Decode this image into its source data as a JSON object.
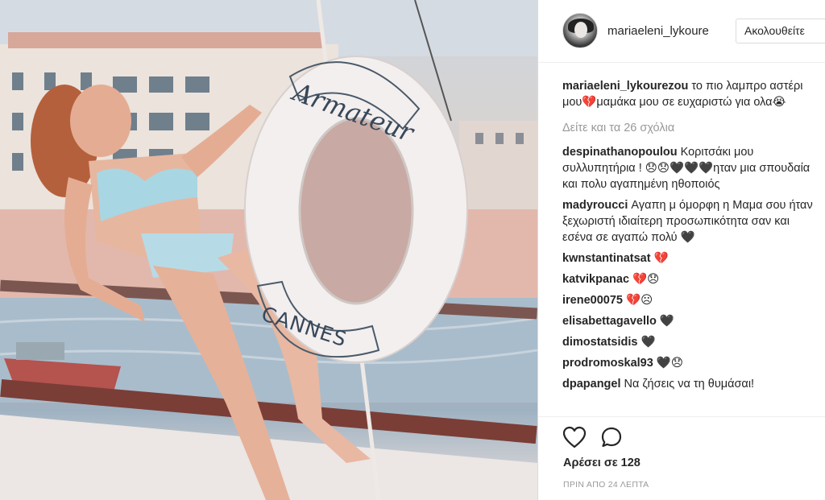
{
  "post": {
    "username": "mariaeleni_lykoure",
    "follow_label": "Ακολουθείτε",
    "caption_user": "mariaeleni_lykourezou",
    "caption_text": " το πιο λαμπρο αστέρι μου💔μαμάκα μου σε ευχαριστώ για ολα😭",
    "view_all": "Δείτε και τα 26 σχόλια",
    "likes": "Αρέσει σε 128",
    "time": "ΠΡΙΝ ΑΠΟ 24 ΛΕΠΤΑ"
  },
  "comments": [
    {
      "user": "despinathanopoulou",
      "text": " Κοριτσάκι μου συλλυπητήρια ! 😞😞🖤🖤🖤ηταν μια σπουδαία και πολυ αγαπημένη ηθοποιός"
    },
    {
      "user": "madyroucci",
      "text": " Αγαπη μ όμορφη η Μαμα σου ήταν ξεχωριστή ιδιαίτερη προσωπικότητα σαν και εσένα σε αγαπώ πολύ 🖤"
    },
    {
      "user": "kwnstantinatsat",
      "text": " 💔"
    },
    {
      "user": "katvikpanac",
      "text": " 💔😞"
    },
    {
      "user": "irene00075",
      "text": " 💔☹"
    },
    {
      "user": "elisabettagavello",
      "text": " 🖤"
    },
    {
      "user": "dimostatsidis",
      "text": " 🖤"
    },
    {
      "user": "prodromoskal93",
      "text": " 🖤😞"
    },
    {
      "user": "dpapangel",
      "text": " Να ζήσεις να τη θυμάσαι!"
    }
  ],
  "photo": {
    "buoy_top_text": "Armateur",
    "buoy_bottom_text": "CANNES"
  },
  "icons": {
    "like": "heart-icon",
    "comment": "comment-icon"
  }
}
